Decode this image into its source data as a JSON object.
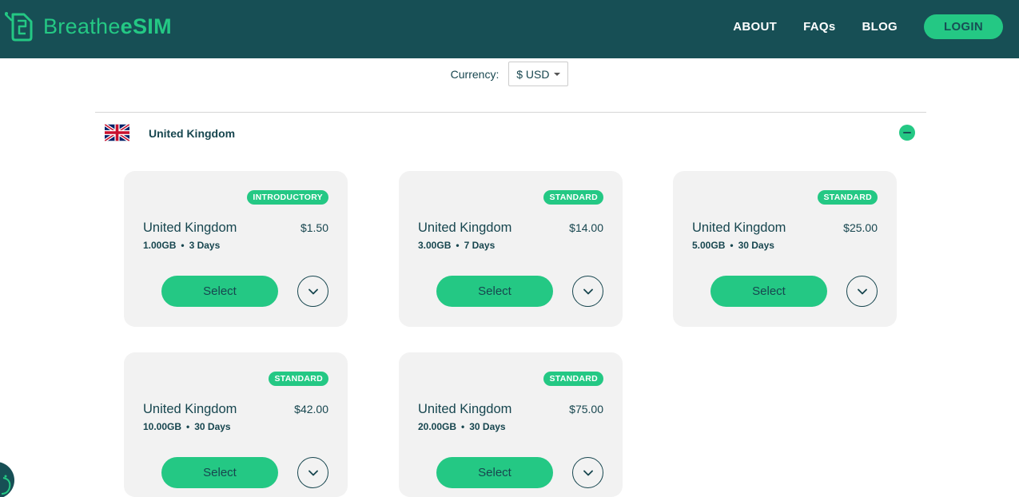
{
  "header": {
    "logo_text_regular": "Breathe",
    "logo_text_bold": "eSIM",
    "nav": [
      {
        "label": "ABOUT"
      },
      {
        "label": "FAQs"
      },
      {
        "label": "BLOG"
      }
    ],
    "login_label": "LOGIN"
  },
  "currency": {
    "label": "Currency:",
    "selected": "$ USD"
  },
  "country": {
    "name": "United Kingdom",
    "flag_icon": "uk-flag-icon"
  },
  "plans": [
    {
      "badge": "INTRODUCTORY",
      "name": "United Kingdom",
      "price": "$1.50",
      "data": "1.00GB",
      "days": "3 Days",
      "select_label": "Select"
    },
    {
      "badge": "STANDARD",
      "name": "United Kingdom",
      "price": "$14.00",
      "data": "3.00GB",
      "days": "7 Days",
      "select_label": "Select"
    },
    {
      "badge": "STANDARD",
      "name": "United Kingdom",
      "price": "$25.00",
      "data": "5.00GB",
      "days": "30 Days",
      "select_label": "Select"
    },
    {
      "badge": "STANDARD",
      "name": "United Kingdom",
      "price": "$42.00",
      "data": "10.00GB",
      "days": "30 Days",
      "select_label": "Select"
    },
    {
      "badge": "STANDARD",
      "name": "United Kingdom",
      "price": "$75.00",
      "data": "20.00GB",
      "days": "30 Days",
      "select_label": "Select"
    }
  ],
  "colors": {
    "header_bg": "#174f55",
    "accent": "#24c884",
    "card_bg": "#f2f2f2",
    "text": "#17464f"
  }
}
